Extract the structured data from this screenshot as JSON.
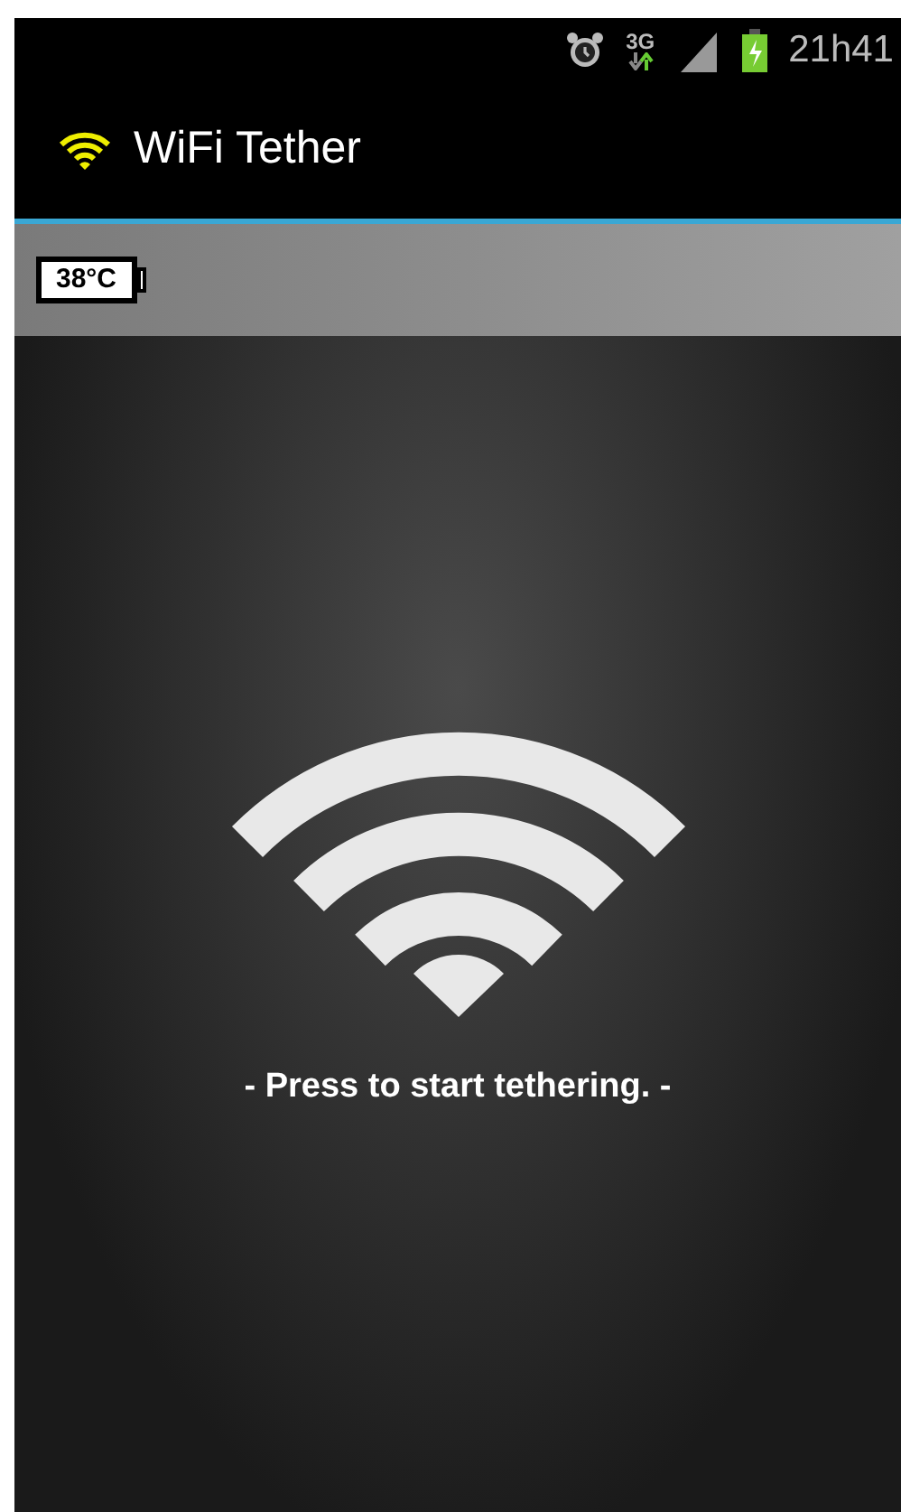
{
  "status_bar": {
    "network": "3G",
    "time": "21h41"
  },
  "action_bar": {
    "title": "WiFi Tether"
  },
  "temperature": {
    "reading": "38°C"
  },
  "main": {
    "hint": "- Press to start tethering. -"
  }
}
